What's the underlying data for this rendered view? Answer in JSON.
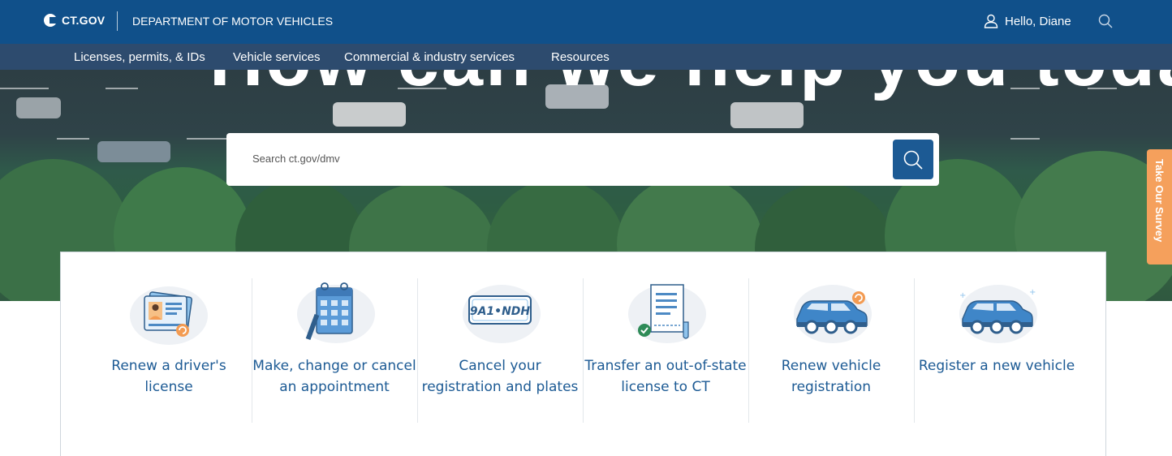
{
  "header": {
    "logo_text": "CT.GOV",
    "department": "DEPARTMENT OF MOTOR VEHICLES",
    "greeting": "Hello, Diane",
    "user_icon": "user-icon",
    "search_icon": "search-icon"
  },
  "nav": {
    "items": [
      {
        "label": "Licenses, permits, & IDs"
      },
      {
        "label": "Vehicle services"
      },
      {
        "label": "Commercial & industry services"
      },
      {
        "label": "Resources"
      }
    ]
  },
  "hero": {
    "title": "How can we help you today?",
    "search_placeholder": "Search ct.gov/dmv",
    "search_button_icon": "search-icon"
  },
  "survey": {
    "label": "Take Our Survey"
  },
  "tiles": [
    {
      "label": "Renew a driver's license",
      "icon": "drivers-license-icon"
    },
    {
      "label": "Make, change or cancel an appointment",
      "icon": "calendar-icon"
    },
    {
      "label": "Cancel your registration and plates",
      "icon": "license-plate-icon",
      "plate_text": "9A1•NDH"
    },
    {
      "label": "Transfer an out-of-state license to CT",
      "icon": "document-icon"
    },
    {
      "label": "Renew vehicle registration",
      "icon": "car-renew-icon"
    },
    {
      "label": "Register a new vehicle",
      "icon": "car-icon"
    }
  ],
  "colors": {
    "primary": "#10508a",
    "accent": "#1c5a94",
    "survey": "#f5a05c"
  }
}
